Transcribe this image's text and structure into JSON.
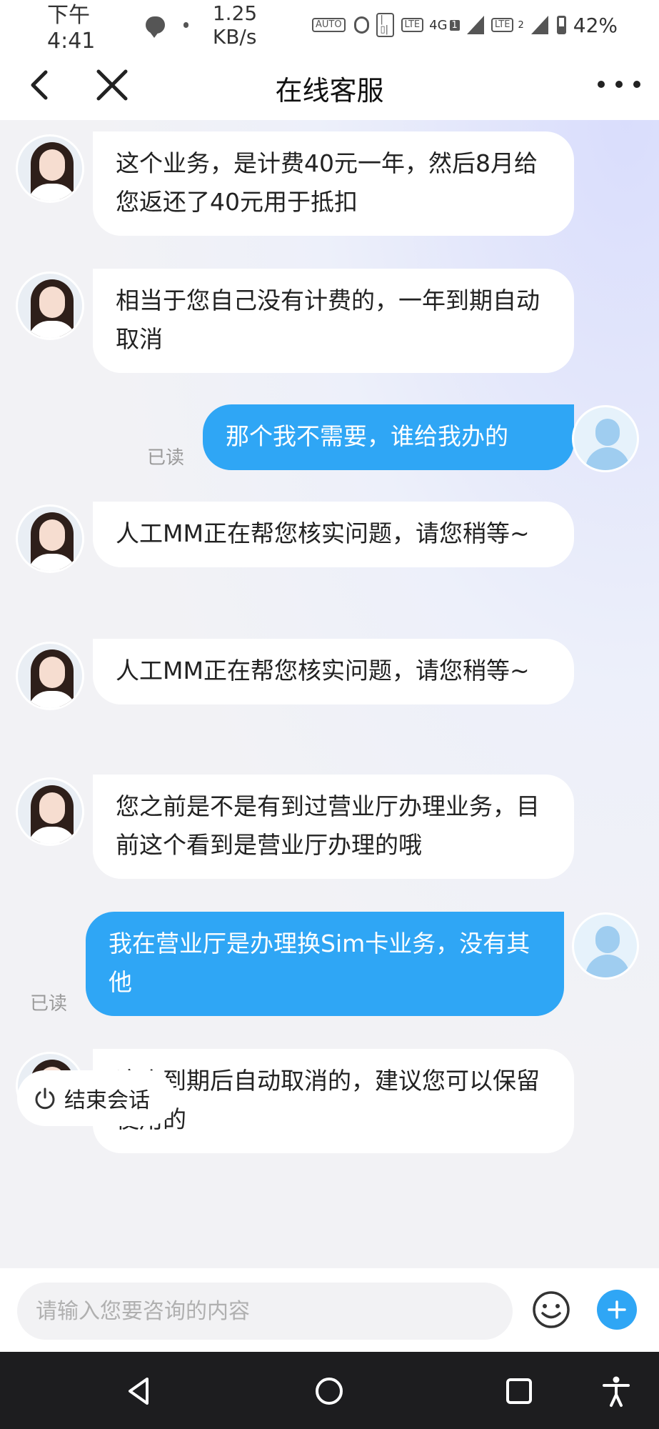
{
  "status_bar": {
    "time": "下午4:41",
    "speed": "1.25 KB/s",
    "icons": [
      "chat-icon",
      "dot",
      "auto-icon",
      "alarm-icon",
      "vibrate-icon",
      "volte-icon",
      "4g-signal-icon",
      "volte-icon-2",
      "signal-icon-2",
      "battery-icon"
    ],
    "network": "4G",
    "sim1_badge": "1",
    "sim2_badge": "2",
    "battery": "42%",
    "battery_level": 0.42
  },
  "header": {
    "title": "在线客服"
  },
  "messages": [
    {
      "sender": "agent",
      "text": "这个业务，是计费40元一年，然后8月给您返还了40元用于抵扣"
    },
    {
      "sender": "agent",
      "text": "相当于您自己没有计费的，一年到期自动取消"
    },
    {
      "sender": "user",
      "text": "那个我不需要，谁给我办的",
      "status": "已读"
    },
    {
      "sender": "agent",
      "text": "人工MM正在帮您核实问题，请您稍等~"
    },
    {
      "sender": "agent",
      "text": "人工MM正在帮您核实问题，请您稍等~"
    },
    {
      "sender": "agent",
      "text": "您之前是不是有到过营业厅办理业务，目前这个看到是营业厅办理的哦"
    },
    {
      "sender": "user",
      "text": "我在营业厅是办理换Sim卡业务，没有其他",
      "status": "已读"
    },
    {
      "sender": "agent",
      "text": "这个到期后自动取消的，建议您可以保留使用的"
    }
  ],
  "end_session": {
    "label": "结束会话"
  },
  "input": {
    "placeholder": "请输入您要咨询的内容",
    "value": ""
  },
  "colors": {
    "accent": "#2fa6f5",
    "agent_bubble": "#ffffff",
    "nav_bar": "#1d1d1f"
  }
}
